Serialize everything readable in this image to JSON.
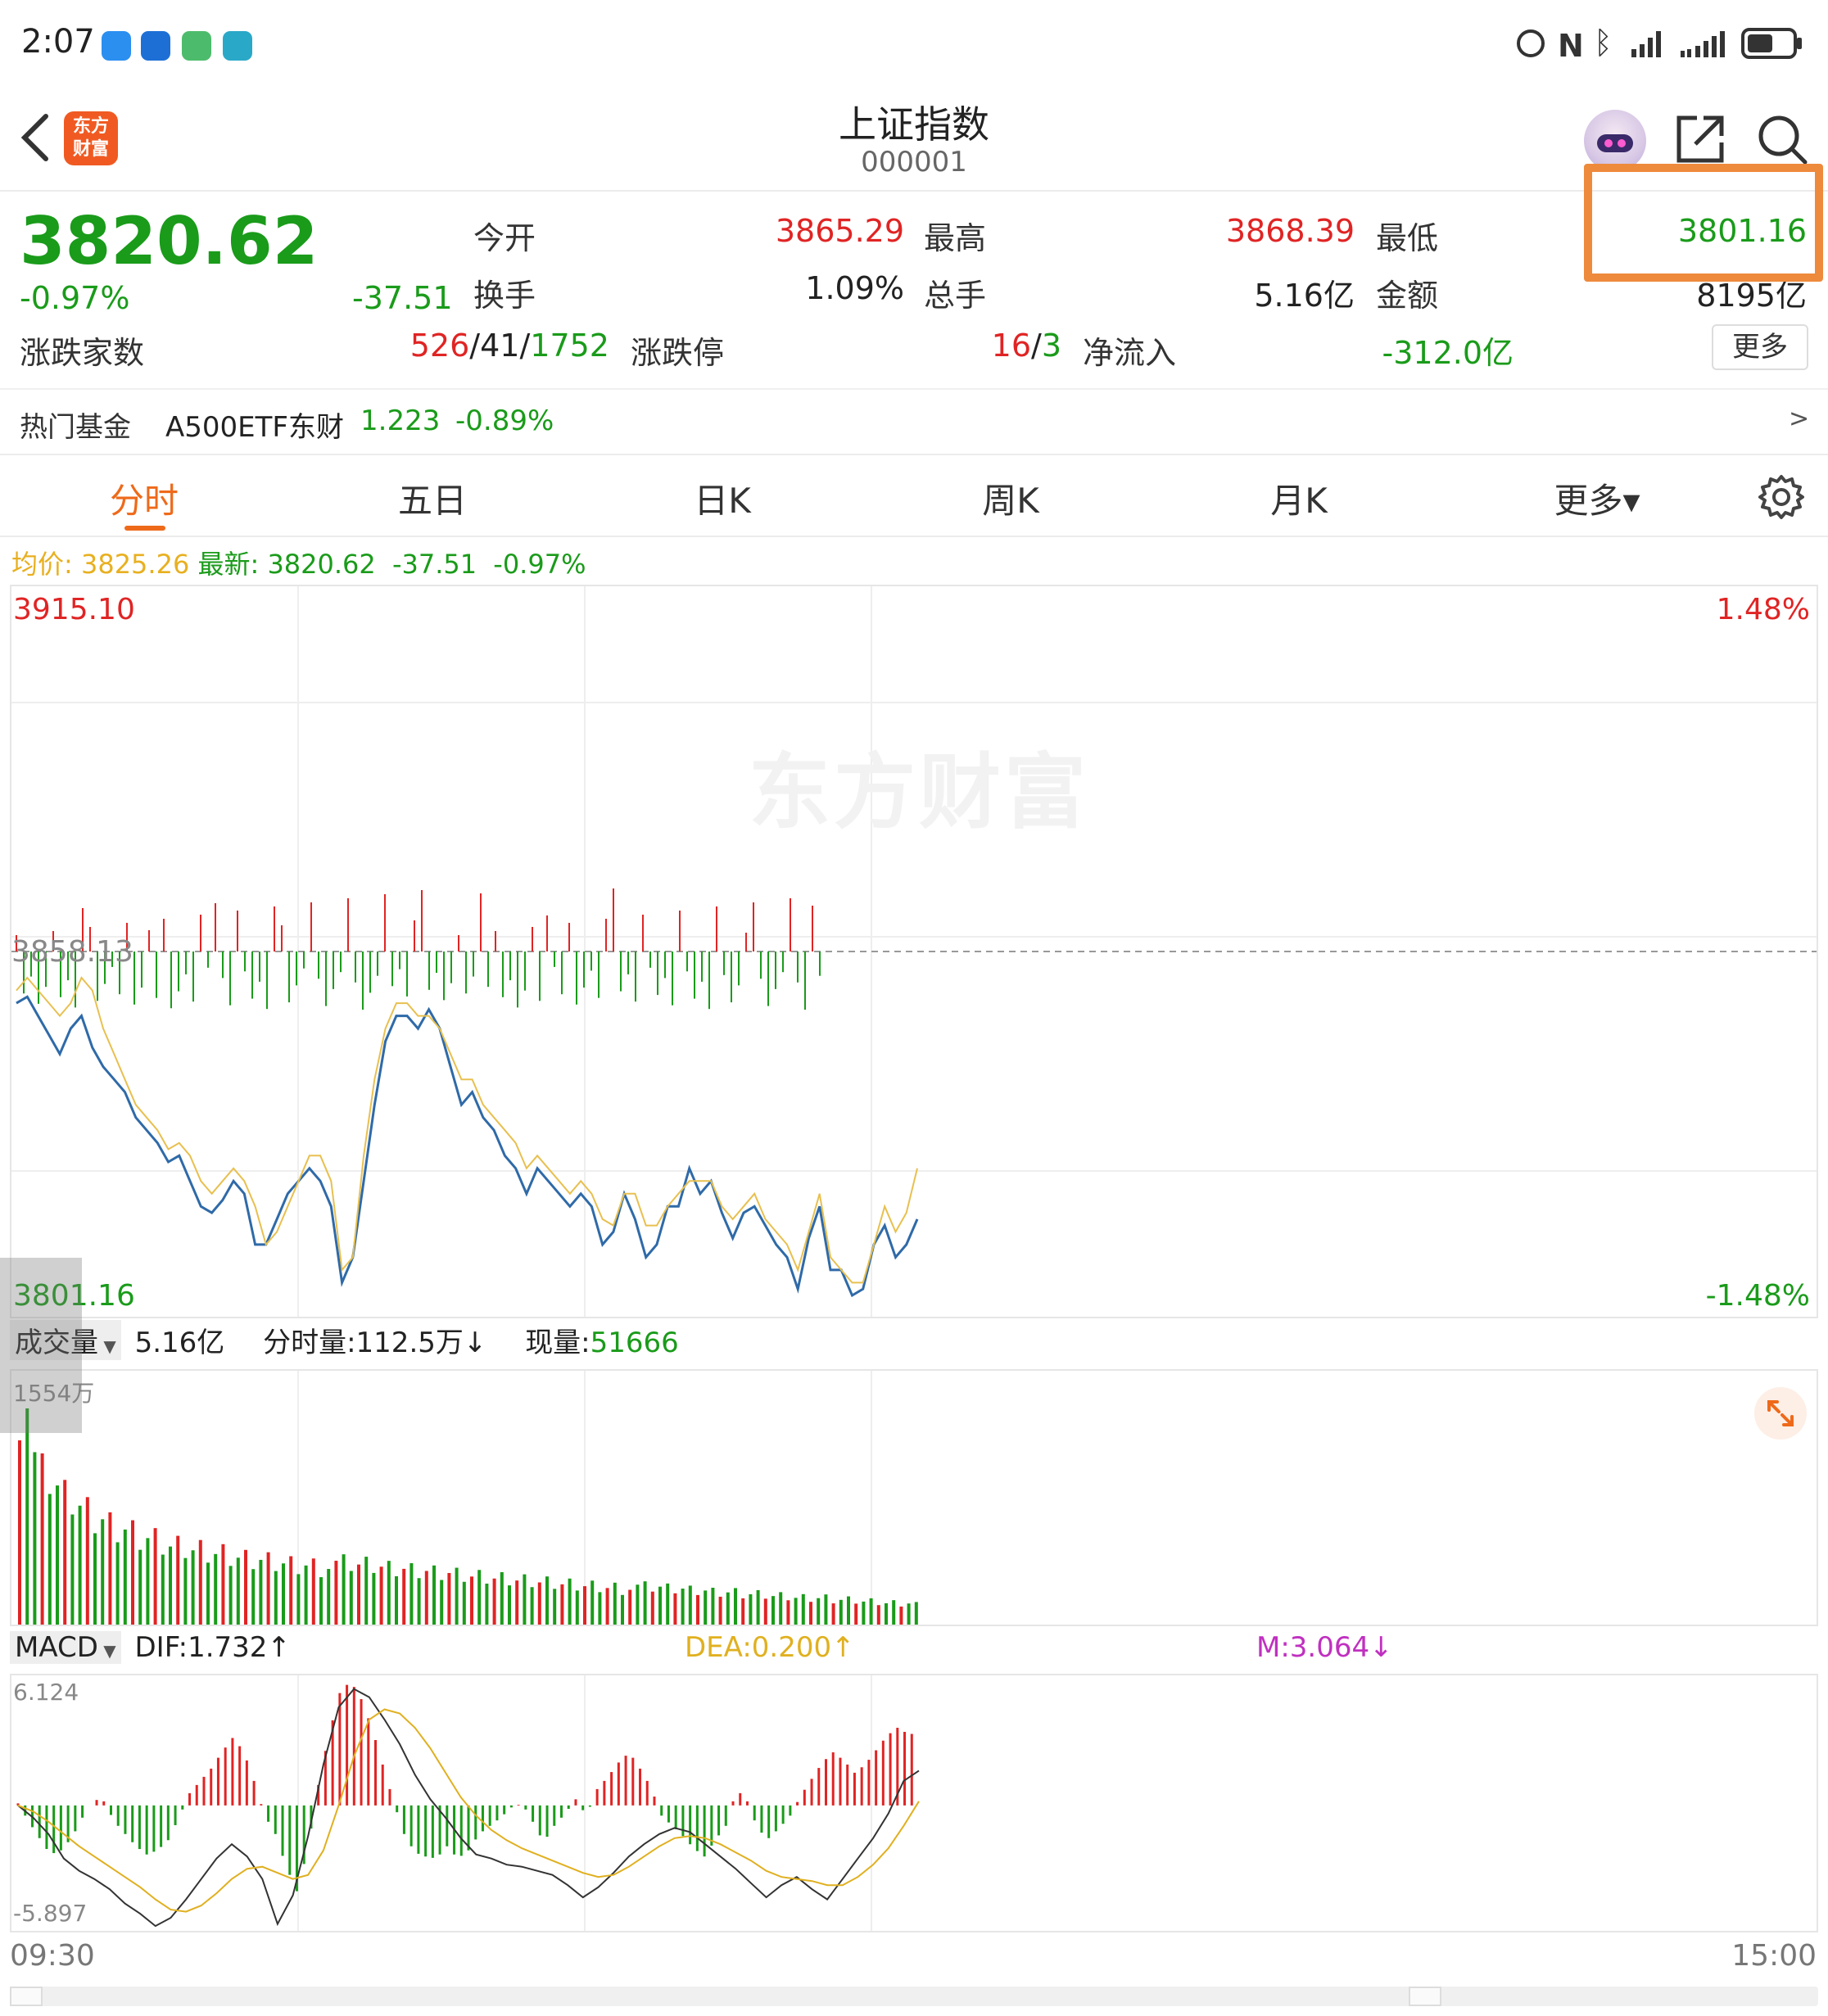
{
  "status": {
    "time": "2:07"
  },
  "header": {
    "title": "上证指数",
    "code": "000001",
    "logo": [
      "东方",
      "财富"
    ]
  },
  "quote": {
    "price": "3820.62",
    "pct": "-0.97%",
    "change": "-37.51",
    "labels": {
      "open": "今开",
      "high": "最高",
      "low": "最低",
      "turnover": "换手",
      "volume": "总手",
      "amount": "金额",
      "updown": "涨跌家数",
      "limit": "涨跌停",
      "netflow": "净流入"
    },
    "values": {
      "open": "3865.29",
      "high": "3868.39",
      "low": "3801.16",
      "turnover": "1.09%",
      "volume": "5.16亿",
      "amount": "8195亿",
      "netflow": "-312.0亿"
    },
    "updown": {
      "up": "526",
      "flat": "41",
      "down": "1752",
      "sep": "/"
    },
    "limit": {
      "up": "16",
      "down": "3",
      "sep": "/"
    },
    "more": "更多"
  },
  "fund": {
    "label": "热门基金",
    "name": "A500ETF东财",
    "price": "1.223",
    "pct": "-0.89%",
    "arrow": ">"
  },
  "tabs": [
    "分时",
    "五日",
    "日K",
    "周K",
    "月K",
    "更多▾"
  ],
  "active_tab": "分时",
  "legend": {
    "avg_label": "均价:",
    "avg": "3825.26",
    "latest_label": "最新:",
    "latest": "3820.62",
    "chg": "-37.51",
    "pct": "-0.97%"
  },
  "watermark": "东方财富",
  "colors": {
    "up": "#e02424",
    "down": "#1a9b1a",
    "accent": "#ee7a1a",
    "price_line": "#2f6aa8",
    "avg_line": "#e8c050",
    "dea": "#e0b020",
    "m": "#c030c0"
  },
  "chart_data": [
    {
      "type": "line",
      "title": "",
      "y_max_label": "3915.10",
      "y_min_label": "3801.16",
      "y_mid_label": "3858.13",
      "pct_max_label": "1.48%",
      "pct_min_label": "-1.48%",
      "ylim": [
        3801.16,
        3915.1
      ],
      "x_start": "09:30",
      "x_end": "15:00",
      "series": [
        {
          "name": "最新",
          "values": [
            3850,
            3851,
            3848,
            3845,
            3842,
            3846,
            3848,
            3843,
            3840,
            3838,
            3836,
            3832,
            3830,
            3828,
            3825,
            3826,
            3822,
            3818,
            3817,
            3819,
            3822,
            3820,
            3812,
            3812,
            3816,
            3820,
            3822,
            3824,
            3822,
            3818,
            3806,
            3810,
            3822,
            3834,
            3844,
            3848,
            3848,
            3846,
            3849,
            3846,
            3840,
            3834,
            3836,
            3832,
            3830,
            3826,
            3824,
            3820,
            3824,
            3822,
            3820,
            3818,
            3820,
            3818,
            3812,
            3814,
            3820,
            3816,
            3810,
            3812,
            3818,
            3818,
            3824,
            3820,
            3822,
            3817,
            3813,
            3817,
            3818,
            3815,
            3812,
            3810,
            3805,
            3813,
            3818,
            3808,
            3808,
            3804,
            3805,
            3812,
            3815,
            3810,
            3812,
            3816
          ],
          "raw_points_are_estimated": true
        },
        {
          "name": "均价",
          "values": [
            3852,
            3854,
            3852,
            3850,
            3848,
            3850,
            3854,
            3852,
            3846,
            3842,
            3838,
            3834,
            3832,
            3830,
            3827,
            3828,
            3826,
            3822,
            3820,
            3822,
            3824,
            3822,
            3818,
            3812,
            3814,
            3818,
            3822,
            3826,
            3826,
            3822,
            3808,
            3810,
            3826,
            3838,
            3846,
            3850,
            3850,
            3848,
            3848,
            3846,
            3842,
            3838,
            3838,
            3834,
            3832,
            3830,
            3828,
            3824,
            3826,
            3824,
            3822,
            3820,
            3822,
            3820,
            3816,
            3815,
            3820,
            3820,
            3815,
            3815,
            3818,
            3820,
            3822,
            3822,
            3822,
            3818,
            3816,
            3818,
            3820,
            3816,
            3814,
            3812,
            3808,
            3814,
            3820,
            3810,
            3808,
            3806,
            3806,
            3812,
            3818,
            3814,
            3817,
            3824
          ]
        }
      ]
    },
    {
      "type": "bar",
      "title": "成交量",
      "total": "5.16亿",
      "minute_vol_label": "分时量:",
      "minute_vol": "112.5万↓",
      "now_label": "现量:",
      "now": "51666",
      "y_max_label": "1554万",
      "values": [
        1554,
        1080,
        950,
        880,
        810,
        760,
        720,
        680,
        640,
        620,
        600,
        570,
        560,
        540,
        520,
        520,
        500,
        490,
        480,
        470,
        460,
        450,
        450,
        440,
        430,
        420,
        420,
        410,
        400,
        400,
        390,
        380,
        380,
        370,
        360,
        360,
        350,
        350,
        340,
        340,
        330,
        330,
        320,
        320,
        310,
        310,
        300,
        300,
        290,
        290,
        280,
        280,
        270,
        270,
        260,
        260,
        250,
        250,
        240,
        240,
        230,
        230,
        220,
        220,
        210,
        210,
        210,
        200,
        200,
        200,
        190,
        190,
        180,
        180,
        180,
        170,
        170,
        170,
        160,
        160,
        150,
        150,
        150,
        140
      ]
    },
    {
      "type": "bar",
      "title": "MACD",
      "dif_label": "DIF:",
      "dif": "1.732↑",
      "dea_label": "DEA:",
      "dea": "0.200↑",
      "m_label": "M:",
      "m": "3.064↓",
      "y_max_label": "6.124",
      "y_min_label": "-5.897",
      "ylim": [
        -5.897,
        6.124
      ],
      "values": [
        0.1,
        -0.8,
        -1.6,
        -2.4,
        -2.2,
        -1.6,
        -0.6,
        0.3,
        0.2,
        -0.8,
        -1.4,
        -2.0,
        -2.4,
        -2.2,
        -1.7,
        -0.6,
        0.6,
        1.2,
        1.8,
        2.6,
        3.3,
        2.7,
        1.2,
        -0.5,
        -1.4,
        -3.0,
        -4.2,
        -2.2,
        1.0,
        3.5,
        5.5,
        6.1,
        5.2,
        3.8,
        2.0,
        0.2,
        -1.4,
        -2.3,
        -2.5,
        -2.6,
        -2.0,
        -2.6,
        -2.2,
        -1.4,
        -1.0,
        -0.6,
        -0.1,
        0.1,
        -0.8,
        -1.8,
        -1.0,
        -0.4,
        0.3,
        -0.5,
        0.8,
        1.4,
        2.1,
        2.6,
        1.8,
        0.9,
        -0.5,
        -1.0,
        -1.5,
        -2.1,
        -2.5,
        -1.7,
        -1.0,
        0.8,
        0.2,
        -1.2,
        -1.6,
        -1.1,
        -0.5,
        0.5,
        1.3,
        2.1,
        2.6,
        2.2,
        1.6,
        2.0,
        2.7,
        3.4,
        3.8,
        3.5
      ],
      "series": [
        {
          "name": "DIF",
          "values": [
            0,
            -0.6,
            -1.4,
            -2.6,
            -3.2,
            -3.6,
            -4.1,
            -4.8,
            -5.3,
            -5.9,
            -5.5,
            -4.6,
            -3.6,
            -2.6,
            -1.9,
            -2.5,
            -3.6,
            -5.8,
            -4.4,
            -1.5,
            2.0,
            4.8,
            5.7,
            5.3,
            4.2,
            3.0,
            1.5,
            0.3,
            -0.6,
            -1.6,
            -2.4,
            -2.6,
            -2.9,
            -3.0,
            -3.2,
            -3.4,
            -3.9,
            -4.5,
            -4.0,
            -3.3,
            -2.5,
            -1.9,
            -1.4,
            -1.1,
            -1.3,
            -1.9,
            -2.5,
            -3.1,
            -3.8,
            -4.5,
            -3.9,
            -3.5,
            -4.1,
            -4.6,
            -3.6,
            -2.6,
            -1.6,
            -0.4,
            1.2,
            1.7
          ]
        },
        {
          "name": "DEA",
          "values": [
            0,
            -0.3,
            -0.8,
            -1.4,
            -2.0,
            -2.5,
            -3.0,
            -3.5,
            -4.0,
            -4.6,
            -5.1,
            -5.2,
            -4.9,
            -4.3,
            -3.6,
            -3.1,
            -3.0,
            -3.3,
            -3.6,
            -3.4,
            -2.2,
            0.0,
            2.4,
            4.2,
            4.7,
            4.5,
            3.8,
            2.8,
            1.6,
            0.4,
            -0.5,
            -1.2,
            -1.7,
            -2.1,
            -2.4,
            -2.7,
            -3.0,
            -3.3,
            -3.5,
            -3.4,
            -3.0,
            -2.5,
            -2.0,
            -1.6,
            -1.5,
            -1.6,
            -1.9,
            -2.3,
            -2.7,
            -3.2,
            -3.5,
            -3.6,
            -3.7,
            -3.9,
            -3.9,
            -3.5,
            -2.9,
            -2.1,
            -1.0,
            0.2
          ]
        }
      ]
    }
  ]
}
